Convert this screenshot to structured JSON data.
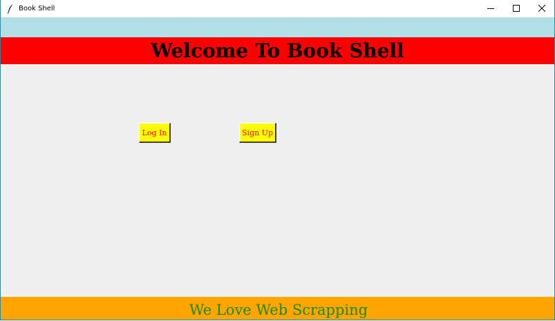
{
  "window": {
    "title": "Book Shell",
    "app_icon": "feather-icon",
    "controls": {
      "minimize_icon": "minimize-icon",
      "maximize_icon": "maximize-icon",
      "close_icon": "close-icon"
    }
  },
  "header": {
    "title": "Welcome To Book Shell",
    "background": "#ff0000"
  },
  "top_band": {
    "background": "#b0e0e6"
  },
  "buttons": {
    "login_label": "Log In",
    "signup_label": "Sign Up",
    "background": "#ffff00",
    "text_color": "#ff0000"
  },
  "footer": {
    "text": "We Love Web Scrapping",
    "background": "#ffa500",
    "text_color": "#1a8a1a"
  }
}
